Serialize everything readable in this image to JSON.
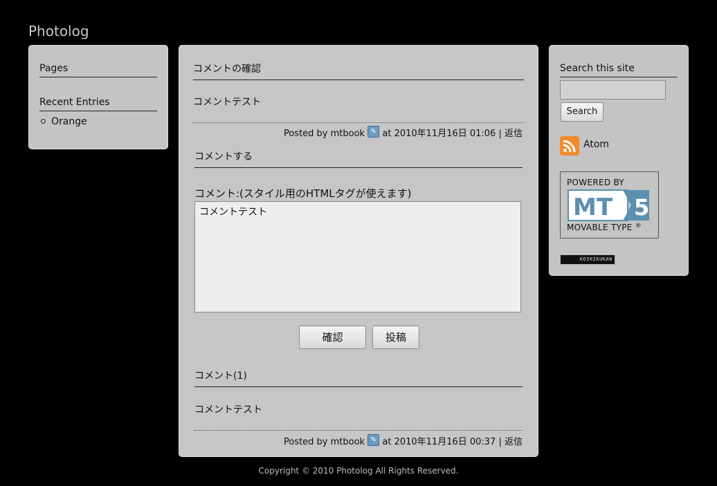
{
  "site": {
    "title": "Photolog"
  },
  "sidebar_left": {
    "pages_title": "Pages",
    "recent_title": "Recent Entries",
    "recent_items": [
      "Orange"
    ]
  },
  "entry": {
    "confirm_title": "コメントの確認",
    "preview_text": "コメントテスト",
    "preview_meta": {
      "prefix": "Posted by ",
      "author": "mtbook",
      "at": " at 2010年11月16日 01:06 | ",
      "reply": "返信"
    }
  },
  "comment_form": {
    "title": "コメントする",
    "label": "コメント:(スタイル用のHTMLタグが使えます)",
    "textarea_value": "コメントテスト",
    "confirm_button": "確認",
    "post_button": "投稿"
  },
  "comments": {
    "title": "コメント(1)",
    "items": [
      {
        "text": "コメントテスト",
        "prefix": "Posted by ",
        "author": "mtbook",
        "at": " at 2010年11月16日 00:37 | ",
        "reply": "返信"
      }
    ]
  },
  "sidebar_right": {
    "search_title": "Search this site",
    "search_value": "",
    "search_button": "Search",
    "feed_label": "Atom",
    "powered_by": "POWERED BY",
    "mt_logo_text": "MT",
    "mt_logo_version": "5",
    "movable_type": "MOVABLE TYPE",
    "koiki_label": "KOIKIKUKAN"
  },
  "colors": {
    "background": "#000000",
    "panel": "#c4c4c4",
    "feed_orange": "#f18a2b",
    "mt_blue": "#5b8fb0"
  },
  "footer": {
    "copyright": "Copyright © 2010 Photolog All Rights Reserved."
  }
}
